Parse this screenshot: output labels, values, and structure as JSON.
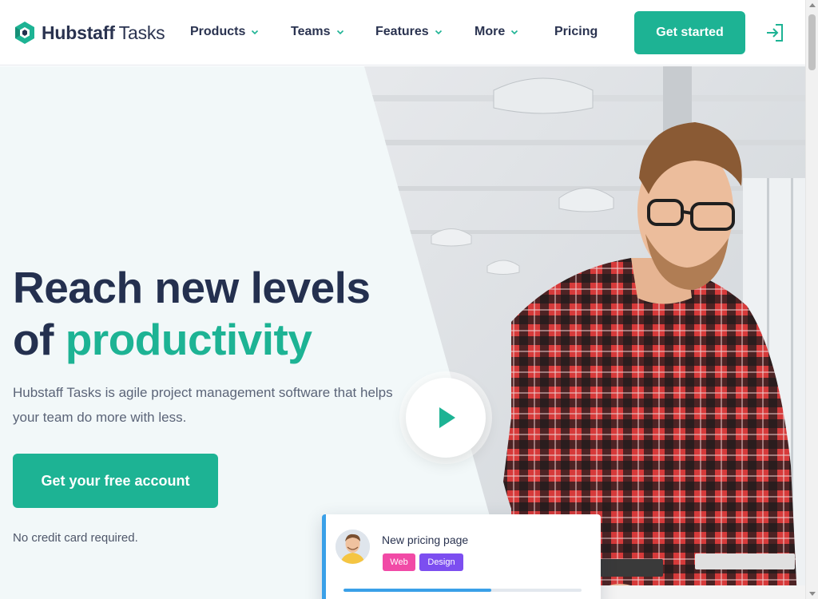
{
  "brand": {
    "name": "Hubstaff",
    "product": "Tasks",
    "accent": "#1db394",
    "dark": "#24304f"
  },
  "nav": {
    "items": [
      {
        "label": "Products",
        "has_dropdown": true
      },
      {
        "label": "Teams",
        "has_dropdown": true
      },
      {
        "label": "Features",
        "has_dropdown": true
      },
      {
        "label": "More",
        "has_dropdown": true
      },
      {
        "label": "Pricing",
        "has_dropdown": false
      }
    ],
    "cta_label": "Get started",
    "login_icon": "sign-in-icon"
  },
  "hero": {
    "headline_line1": "Reach new levels",
    "headline_line2_prefix": "of ",
    "headline_accent": "productivity",
    "subtitle": "Hubstaff Tasks is agile project management software that helps your team do more with less.",
    "cta_label": "Get your free account",
    "note": "No credit card required.",
    "play_icon": "play-icon"
  },
  "task_card": {
    "title": "New pricing page",
    "tags": [
      {
        "label": "Web",
        "color": "#f14aa6"
      },
      {
        "label": "Design",
        "color": "#7c4ef0"
      }
    ],
    "progress": 0.62,
    "progress_color": "#3aa0e8"
  }
}
